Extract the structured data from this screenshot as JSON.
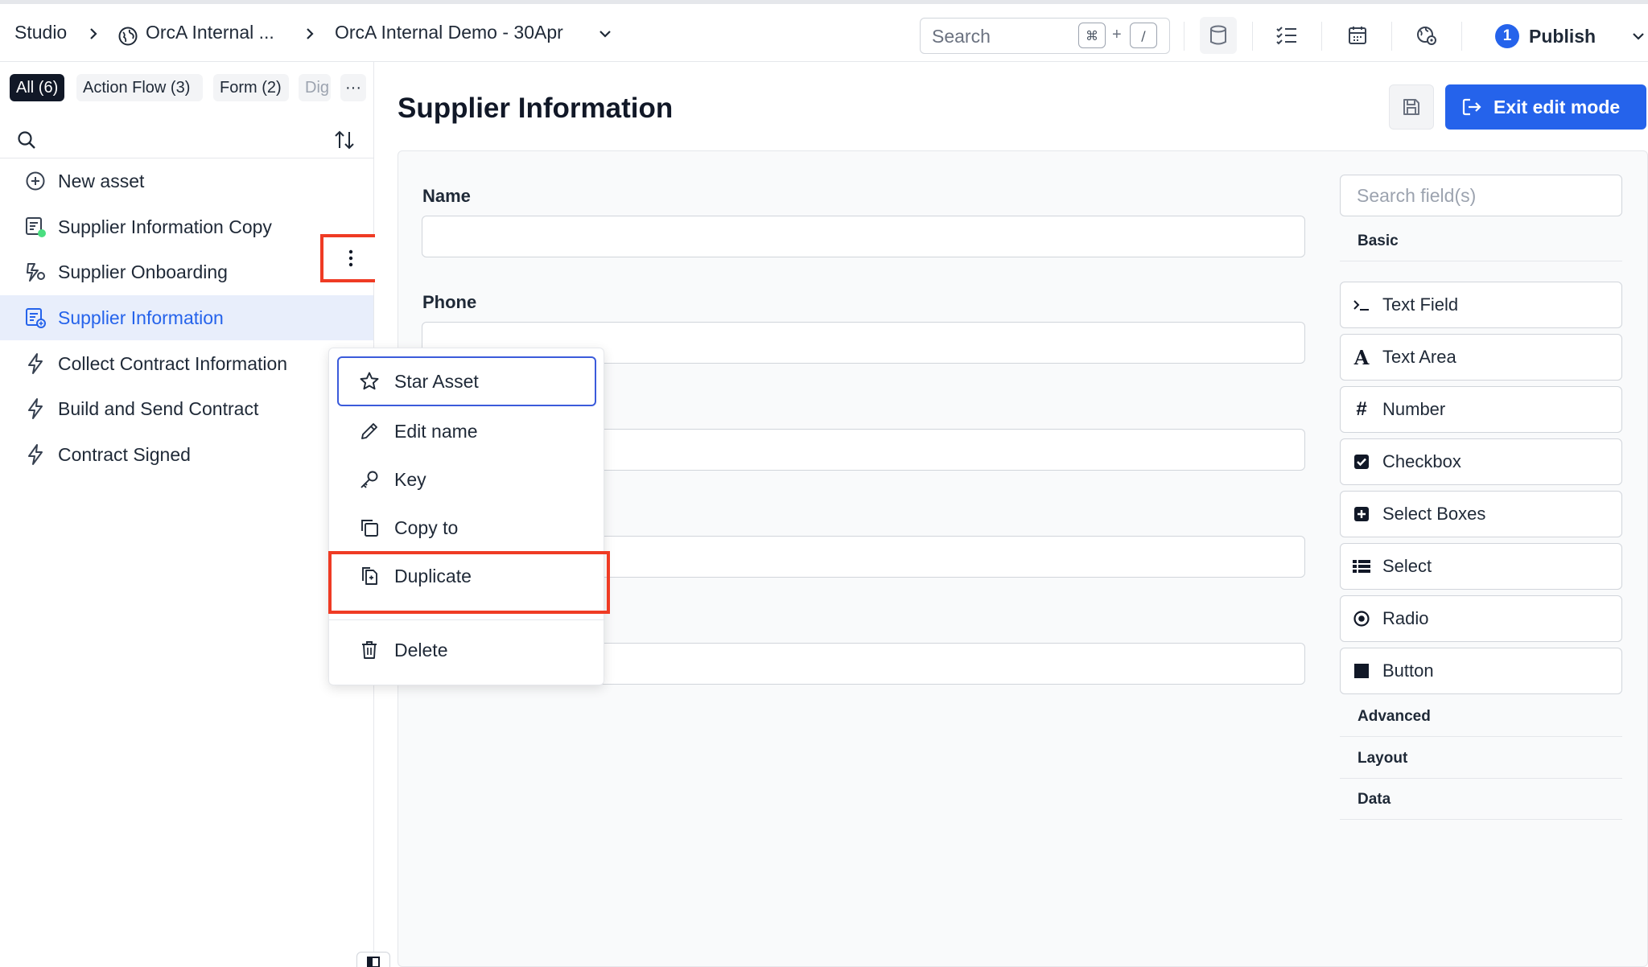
{
  "breadcrumb": {
    "studio": "Studio",
    "org": "OrcA Internal ...",
    "app": "OrcA Internal Demo - 30Apr"
  },
  "top_search": {
    "placeholder": "Search",
    "shortcut_mod": "⌘",
    "shortcut_plus": "+",
    "shortcut_key": "/"
  },
  "toolbar_icons": [
    "database-icon",
    "checklist-icon",
    "calendar-icon",
    "globe-settings-icon"
  ],
  "publish": {
    "count": "1",
    "label": "Publish"
  },
  "filters": [
    {
      "label": "All (6)",
      "active": true
    },
    {
      "label": "Action Flow (3)",
      "active": false
    },
    {
      "label": "Form (2)",
      "active": false
    },
    {
      "label": "Dig",
      "active": false
    }
  ],
  "filters_more": "···",
  "assets": [
    {
      "label": "New asset",
      "icon": "plus-circle-icon"
    },
    {
      "label": "Supplier Information Copy",
      "icon": "form-icon"
    },
    {
      "label": "Supplier Onboarding",
      "icon": "flow-icon"
    },
    {
      "label": "Supplier Information",
      "icon": "form-icon",
      "selected": true
    },
    {
      "label": "Collect Contract Information",
      "icon": "bolt-icon"
    },
    {
      "label": "Build and Send Contract",
      "icon": "bolt-icon"
    },
    {
      "label": "Contract Signed",
      "icon": "bolt-icon"
    }
  ],
  "context_menu": [
    {
      "label": "Star Asset",
      "icon": "star-icon"
    },
    {
      "label": "Edit name",
      "icon": "pencil-icon"
    },
    {
      "label": "Key",
      "icon": "key-icon"
    },
    {
      "label": "Copy to",
      "icon": "copy-icon"
    },
    {
      "label": "Duplicate",
      "icon": "duplicate-icon"
    },
    {
      "label": "Delete",
      "icon": "trash-icon"
    }
  ],
  "main": {
    "title": "Supplier Information",
    "exit_label": "Exit edit mode",
    "fields": [
      {
        "label": "Name"
      },
      {
        "label": "Phone"
      }
    ]
  },
  "palette": {
    "search_placeholder": "Search field(s)",
    "basic_label": "Basic",
    "items": [
      {
        "label": "Text Field",
        "icon": "terminal-icon"
      },
      {
        "label": "Text Area",
        "icon": "font-icon"
      },
      {
        "label": "Number",
        "icon": "hash-icon"
      },
      {
        "label": "Checkbox",
        "icon": "checkbox-icon"
      },
      {
        "label": "Select Boxes",
        "icon": "plus-square-icon"
      },
      {
        "label": "Select",
        "icon": "list-icon"
      },
      {
        "label": "Radio",
        "icon": "radio-icon"
      },
      {
        "label": "Button",
        "icon": "square-icon"
      }
    ],
    "sections": [
      "Advanced",
      "Layout",
      "Data"
    ]
  },
  "colors": {
    "accent": "#2563eb",
    "highlight": "#ef3b24",
    "selected_bg": "#e8eefb"
  }
}
